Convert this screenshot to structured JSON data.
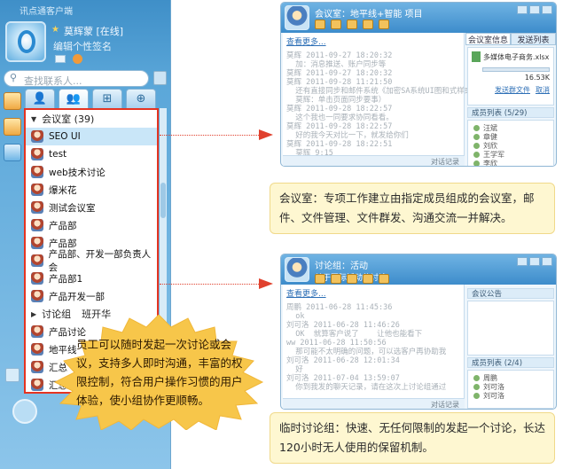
{
  "im": {
    "app_name": "讯点通客户端",
    "nickname": "莫辉蒙 [在线]",
    "signature": "编辑个性签名",
    "search_placeholder": "查找联系人...",
    "tab_icons": [
      "contacts-icon",
      "groups-icon",
      "org-icon",
      "add-icon"
    ],
    "group_head": "会议室 (39)",
    "rows": [
      "SEO UI",
      "test",
      "web技术讨论",
      "爆米花",
      "测试会议室",
      "产品部",
      "产品部",
      "产品部、开发一部负责人会",
      "产品部1",
      "产品开发一部"
    ],
    "group2_head": "讨论组",
    "group2_suffix": "班开华",
    "partial_rows": [
      "产品讨论",
      "地平线",
      "汇总",
      "汇总"
    ]
  },
  "meeting_window": {
    "title": "会议室：地平线+智能 项目",
    "more_link": "查看更多...",
    "messages": [
      "莫辉 2011-09-27 18:20:32",
      "  加：消息推送、账户同步等",
      "莫辉 2011-09-27 18:20:32",
      "莫辉 2011-09-28 11:21:50",
      "  还有直接同步和邮件系统《加密SA系统UI图和式样或正式",
      "  莫辉：单击页面同步要事）",
      "莫辉 2011-09-28 18:22:57",
      "  这个我也一同要求协同看看。",
      "莫辉 2011-09-28 18:22:57",
      "  好的我今天对比一下，就发给你们",
      "莫辉 2011-09-28 18:22:51",
      "  莫辉 9:15"
    ],
    "record_label": "对话记录",
    "side_tabs": [
      "会议室信息",
      "发送列表"
    ],
    "file_name": "多媒体电子商务.xlsx",
    "file_size": "16.53K",
    "file_actions": [
      "发送群文件",
      "取消"
    ],
    "members_title": "成员列表 (5/29)",
    "members": [
      "汪斌",
      "章健",
      "刘欣",
      "王学军",
      "李欣"
    ]
  },
  "discussion_window": {
    "title": "讨论组：活动",
    "subtitle": "关于国际活动的讨论",
    "more_link": "查看更多...",
    "messages": [
      "周鹏 2011-06-28 11:45:36",
      "  ok",
      "刘可洛 2011-06-28 11:46:26",
      "  OK  就算客户说了    让他也能看下",
      "ww 2011-06-28 11:50:56",
      "  那可能不太明确的问题，可以选客户再协助我",
      "刘可洛 2011-06-28 12:01:34",
      "  好",
      "刘可洛 2011-07-04 13:59:07",
      "  你到我发的聊天记录，请在这次上讨论组通过"
    ],
    "record_label": "对话记录",
    "side_title": "会议公告",
    "members_title": "成员列表 (2/4)",
    "members": [
      "周鹏",
      "刘可洛",
      "刘可洛"
    ]
  },
  "callouts": {
    "meeting": "会议室：专项工作建立由指定成员组成的会议室，邮件、文件管理、文件群发、沟通交流一并解决。",
    "discussion": "临时讨论组：快速、无任何限制的发起一个讨论，长达120小时无人使用的保留机制。",
    "burst": "员工可以随时发起一次讨论或会议，支持多人即时沟通，丰富的权限控制，符合用户操作习惯的用户体验，使小组协作更顺畅。"
  },
  "colors": {
    "highlight_border": "#e53421",
    "callout_bg": "#fef7d1",
    "burst_fill": "#f7c64a"
  }
}
